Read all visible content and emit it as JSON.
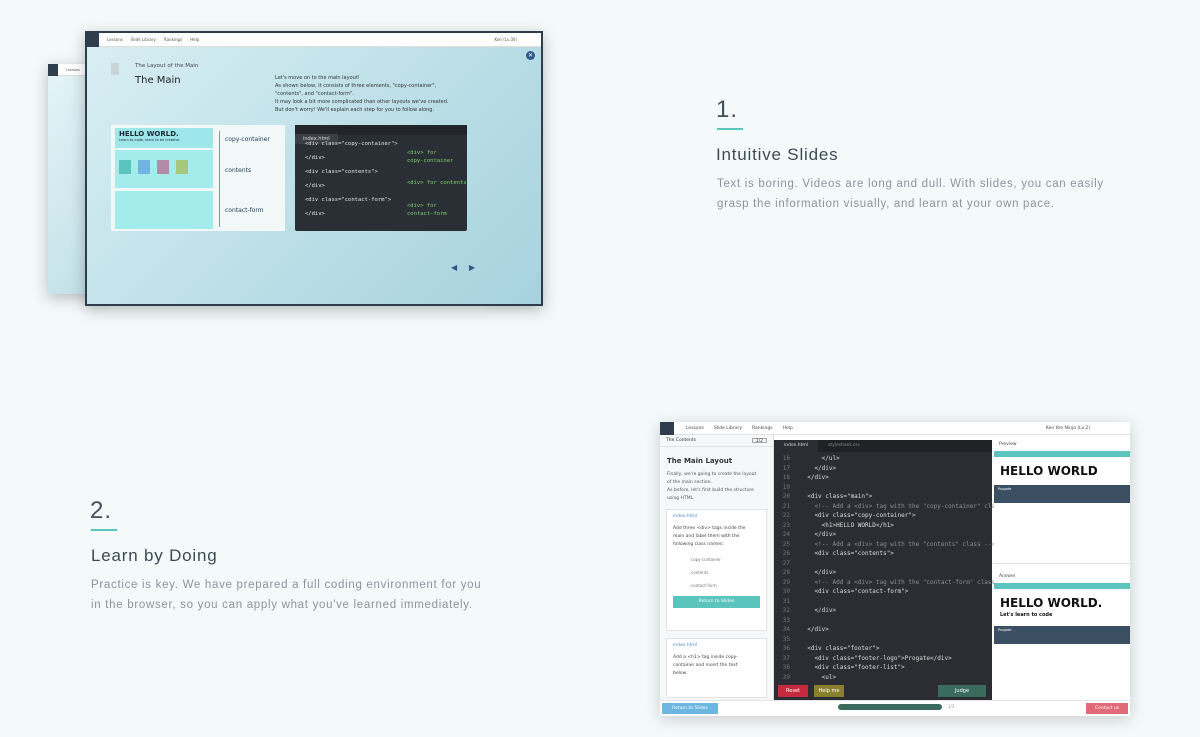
{
  "features": [
    {
      "number": "1.",
      "title": "Intuitive Slides",
      "desc_lines": [
        "Text is boring. Videos are long and dull. With slides, you can easily",
        "grasp the information visually, and learn at your own pace."
      ]
    },
    {
      "number": "2.",
      "title": "Learn by Doing",
      "desc_lines": [
        "Practice is key. We have prepared a full coding environment for you",
        "in the browser, so you can apply what you've learned immediately."
      ]
    }
  ],
  "slide_mock": {
    "nav": [
      "Lessons",
      "Slide Library",
      "Rankings",
      "Help"
    ],
    "user": "Ken (Lv.30)",
    "subtitle": "The Layout of the Main",
    "title": "The Main",
    "body_lines": [
      "Let's move on to the main layout!",
      "As shown below, it consists of three elements, \"copy-container\",",
      "\"contents\", and \"contact-form\".",
      "It may look a bit more complicated than other layouts we've created.",
      "But don't worry! We'll explain each step for you to follow along."
    ],
    "hello": "HELLO WORLD.",
    "hello_sub": "Learn to code, learn to be creative.",
    "labels": [
      "copy-container",
      "contents",
      "contact-form"
    ],
    "file_tab": "index.html",
    "code": [
      {
        "text": "<div class=\"copy-container\">"
      },
      {
        "text": "</div>"
      },
      {
        "text": "<div class=\"contents\">"
      },
      {
        "text": "</div>"
      },
      {
        "text": "<div class=\"contact-form\">"
      },
      {
        "text": "</div>"
      }
    ],
    "annotations": [
      "<div> for",
      "copy-container",
      "<div> for contents",
      "<div> for",
      "contact-form"
    ]
  },
  "editor_mock": {
    "nav": [
      "Lessons",
      "Slide Library",
      "Rankings",
      "Help"
    ],
    "user": "Ken the Ninja (Lv.2)",
    "left_header": "The Contents",
    "left_badge": "1/2",
    "left_title": "The Main Layout",
    "left_para": [
      "Finally, we're going to create the layout",
      "of the main section.",
      "As before, let's first build the structure",
      "using HTML."
    ],
    "task_file": "index.html",
    "task_text": [
      "Add three <div> tags inside the",
      "main and label them with the",
      "following class names:"
    ],
    "task_items": [
      "copy-container",
      "contents",
      "contact-form"
    ],
    "task_button": "Return to Slides",
    "task2_file": "index.html",
    "task2_text": [
      "Add a <h1> tag inside copy-",
      "container and insert the text",
      "below."
    ],
    "tabs": [
      "index.html",
      "stylesheet.css"
    ],
    "code_lines": [
      {
        "n": "16",
        "t": "      </ul>"
      },
      {
        "n": "17",
        "t": "    </div>"
      },
      {
        "n": "18",
        "t": "  </div>"
      },
      {
        "n": "19",
        "t": ""
      },
      {
        "n": "20",
        "t": "  <div class=\"main\">"
      },
      {
        "n": "21",
        "t": "    <!-- Add a <div> tag with the \"copy-container\" class"
      },
      {
        "n": "22",
        "t": "    <div class=\"copy-container\">"
      },
      {
        "n": "23",
        "t": "      <h1>HELLO WORLD</h1>"
      },
      {
        "n": "24",
        "t": "    </div>"
      },
      {
        "n": "25",
        "t": "    <!-- Add a <div> tag with the \"contents\" class -->"
      },
      {
        "n": "26",
        "t": "    <div class=\"contents\">"
      },
      {
        "n": "27",
        "t": ""
      },
      {
        "n": "28",
        "t": "    </div>"
      },
      {
        "n": "29",
        "t": "    <!-- Add a <div> tag with the \"contact-form\" class"
      },
      {
        "n": "30",
        "t": "    <div class=\"contact-form\">"
      },
      {
        "n": "31",
        "t": ""
      },
      {
        "n": "32",
        "t": "    </div>"
      },
      {
        "n": "33",
        "t": ""
      },
      {
        "n": "34",
        "t": "  </div>"
      },
      {
        "n": "35",
        "t": ""
      },
      {
        "n": "36",
        "t": "  <div class=\"footer\">"
      },
      {
        "n": "37",
        "t": "    <div class=\"footer-logo\">Progate</div>"
      },
      {
        "n": "38",
        "t": "    <div class=\"footer-list\">"
      },
      {
        "n": "39",
        "t": "      <ul>"
      }
    ],
    "reset": "Reset",
    "help": "Help me",
    "judge": "Judge",
    "preview_label": "Preview",
    "preview_hello": "HELLO WORLD",
    "answer_label": "Answer",
    "answer_hello": "HELLO WORLD.",
    "answer_sub": "Let's learn to code",
    "brand": "Progate",
    "return_slides": "Return to Slides",
    "page_count": "1/3",
    "contact": "Contact us"
  },
  "colors": {
    "accent": "#5bc5bd",
    "navy": "#2f3e4d",
    "reset": "#c8283e",
    "help": "#8a7f2f",
    "judge": "#3b6b5c"
  }
}
